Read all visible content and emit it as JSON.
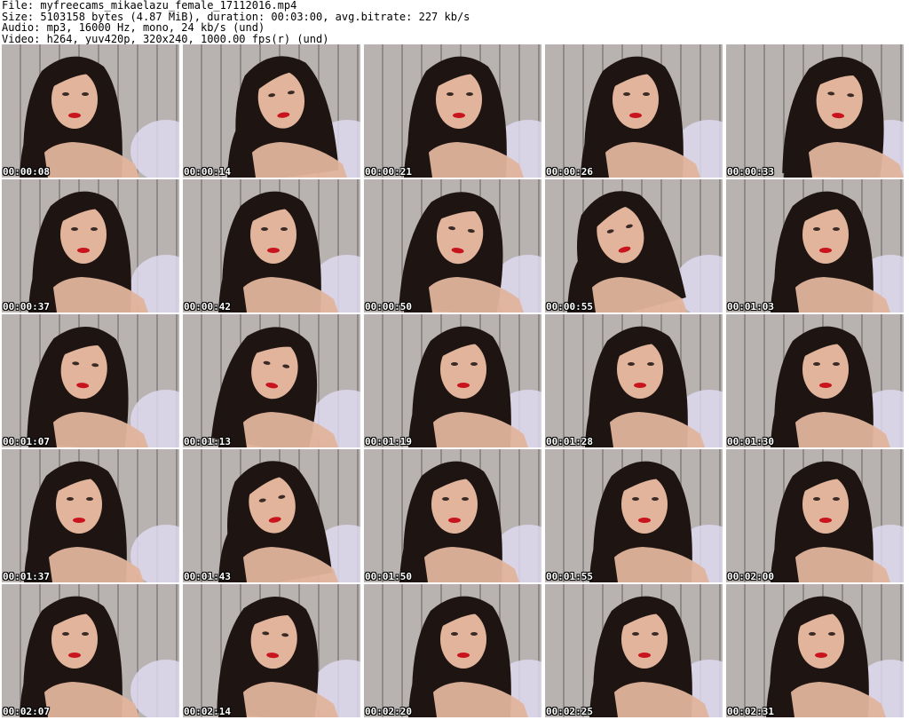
{
  "header": {
    "file_line": "File: myfreecams_mikaelazu_female_17112016.mp4",
    "size_line": "Size: 5103158 bytes (4.87 MiB), duration: 00:03:00, avg.bitrate: 227 kb/s",
    "audio_line": "Audio: mp3, 16000 Hz, mono, 24 kb/s (und)",
    "video_line": "Video: h264, yuv420p, 320x240, 1000.00 fps(r) (und)"
  },
  "thumbnails": [
    {
      "time": "00:00:08"
    },
    {
      "time": "00:00:14"
    },
    {
      "time": "00:00:21"
    },
    {
      "time": "00:00:26"
    },
    {
      "time": "00:00:33"
    },
    {
      "time": "00:00:37"
    },
    {
      "time": "00:00:42"
    },
    {
      "time": "00:00:50"
    },
    {
      "time": "00:00:55"
    },
    {
      "time": "00:01:03"
    },
    {
      "time": "00:01:07"
    },
    {
      "time": "00:01:13"
    },
    {
      "time": "00:01:19"
    },
    {
      "time": "00:01:28"
    },
    {
      "time": "00:01:30"
    },
    {
      "time": "00:01:37"
    },
    {
      "time": "00:01:43"
    },
    {
      "time": "00:01:50"
    },
    {
      "time": "00:01:55"
    },
    {
      "time": "00:02:00"
    },
    {
      "time": "00:02:07"
    },
    {
      "time": "00:02:14"
    },
    {
      "time": "00:02:20"
    },
    {
      "time": "00:02:25"
    },
    {
      "time": "00:02:31"
    }
  ],
  "colors": {
    "background": "#ffffff",
    "wall": "#b8b3b0",
    "plank_line": "#8f8a87",
    "hair": "#1e1512",
    "skin": "#e2b49c",
    "lips": "#c8141c",
    "sofa": "#ddd8ee",
    "timestamp_text": "#ffffff"
  }
}
